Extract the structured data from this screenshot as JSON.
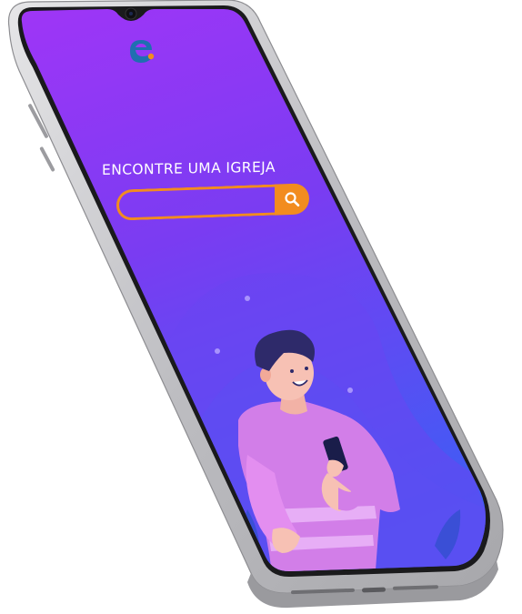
{
  "app": {
    "logo_letter": "e",
    "heading": "ENCONTRE UMA IGREJA"
  },
  "search": {
    "value": "",
    "placeholder": "",
    "button_icon": "search-icon"
  },
  "colors": {
    "screen_top": "#9d35f5",
    "screen_bottom": "#3f5cf3",
    "accent_orange": "#f28c1f",
    "logo_blue": "#1f6fb0",
    "phone_frame": "#c9c9cc"
  }
}
